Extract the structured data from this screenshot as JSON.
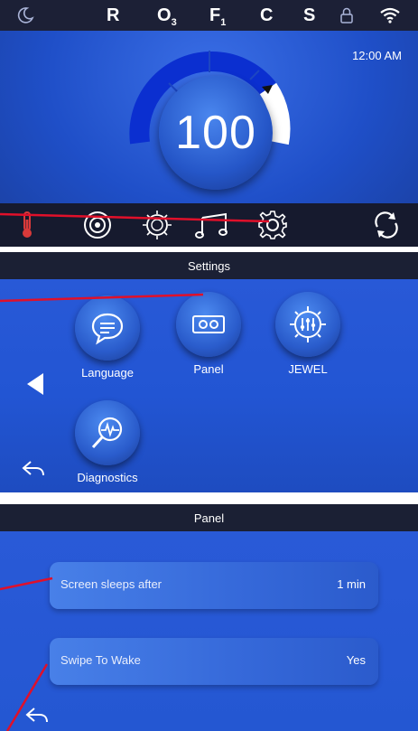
{
  "status_bar": {
    "indicators": [
      {
        "label": "R",
        "sub": ""
      },
      {
        "label": "O",
        "sub": "3"
      },
      {
        "label": "F",
        "sub": "1"
      },
      {
        "label": "C",
        "sub": ""
      },
      {
        "label": "S",
        "sub": ""
      }
    ],
    "icons": [
      "moon-icon",
      "lock-icon",
      "wifi-icon"
    ]
  },
  "home": {
    "time": "12:00 AM",
    "temperature": "100",
    "dial_colors": {
      "active": "#0b2fd0",
      "inactive": "#1f4bbd",
      "marker": "#ffffff"
    },
    "toolbar_icons": [
      "thermometer-icon",
      "jets-icon",
      "light-icon",
      "music-icon",
      "gear-icon",
      "refresh-icon"
    ]
  },
  "settings": {
    "title": "Settings",
    "tiles": [
      {
        "label": "Language",
        "icon": "chat-bubble-icon"
      },
      {
        "label": "Panel",
        "icon": "panel-icon"
      },
      {
        "label": "JEWEL",
        "icon": "jewel-icon"
      },
      {
        "label": "Diagnostics",
        "icon": "magnifier-pulse-icon"
      }
    ]
  },
  "panel": {
    "title": "Panel",
    "rows": [
      {
        "label": "Screen sleeps after",
        "value": "1 min"
      },
      {
        "label": "Swipe To Wake",
        "value": "Yes"
      }
    ]
  },
  "colors": {
    "accent_blue": "#2255d3",
    "bar_dark": "#1b2034",
    "callout_red": "#e0102a"
  }
}
